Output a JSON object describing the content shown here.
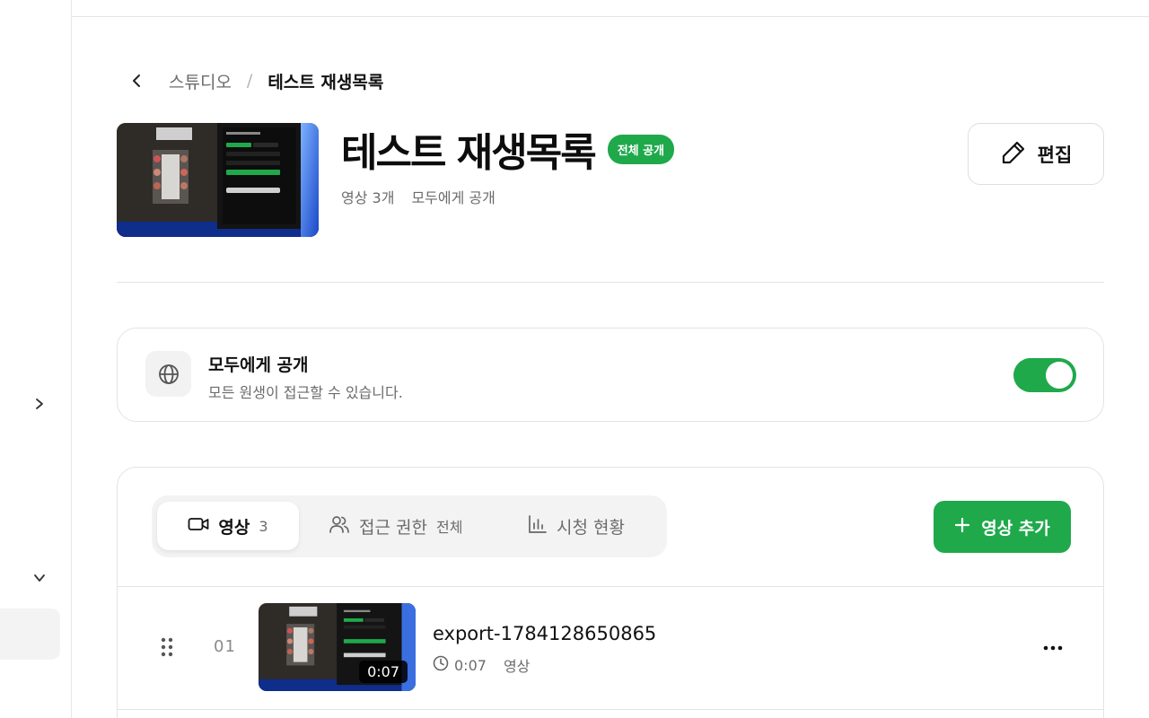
{
  "breadcrumb": {
    "parent": "스튜디오",
    "separator": "/",
    "current": "테스트 재생목록"
  },
  "playlist": {
    "title": "테스트 재생목록",
    "badge": "전체 공개",
    "video_count": "영상 3개",
    "visibility_text": "모두에게 공개",
    "edit_label": "편집"
  },
  "visibility": {
    "title": "모두에게 공개",
    "description": "모든 원생이 접근할 수 있습니다.",
    "enabled": true
  },
  "tabs": [
    {
      "label": "영상",
      "count": "3",
      "icon": "video-icon",
      "active": true
    },
    {
      "label": "접근 권한",
      "sub": "전체",
      "icon": "users-icon",
      "active": false
    },
    {
      "label": "시청 현황",
      "icon": "bar-chart-icon",
      "active": false
    }
  ],
  "add_video_label": "영상 추가",
  "videos": [
    {
      "index": "01",
      "title": "export-1784128650865",
      "duration": "0:07",
      "type": "영상"
    }
  ],
  "colors": {
    "accent": "#1fa94b"
  }
}
